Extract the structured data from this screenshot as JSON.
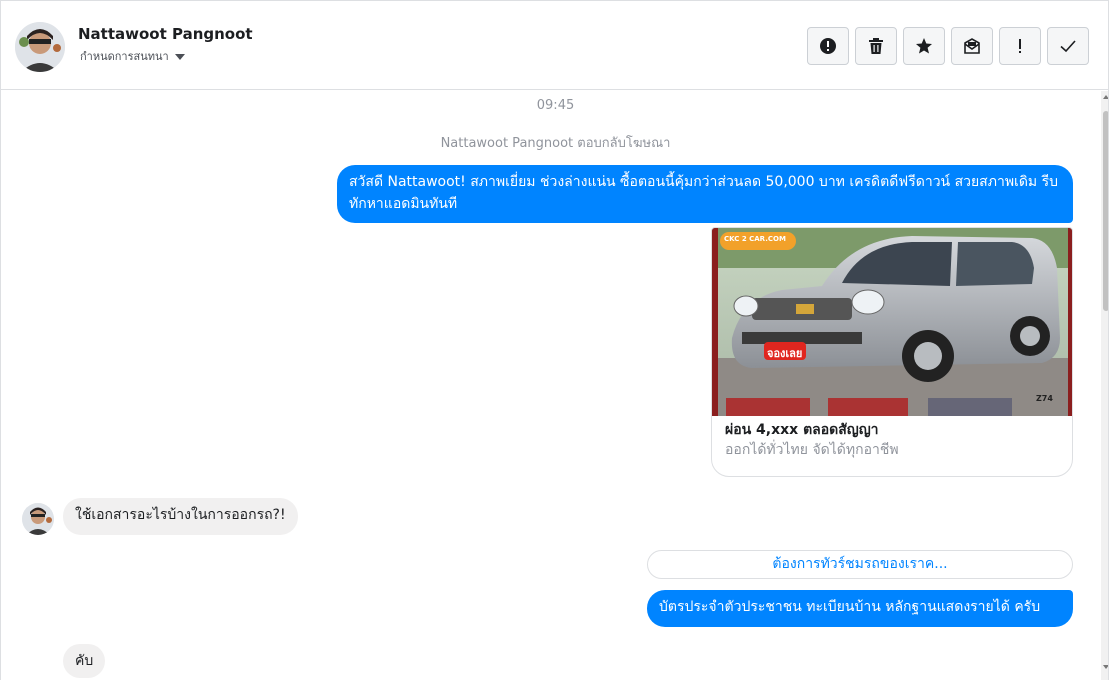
{
  "header": {
    "name": "Nattawoot Pangnoot",
    "subtitle": "กำหนดการสนทนา",
    "actions": [
      {
        "icon": "exclamation-circle-icon",
        "label": "report"
      },
      {
        "icon": "trash-icon",
        "label": "delete"
      },
      {
        "icon": "star-icon",
        "label": "star"
      },
      {
        "icon": "mail-unread-icon",
        "label": "mark-unread"
      },
      {
        "icon": "exclamation-icon",
        "label": "important"
      },
      {
        "icon": "checkmark-icon",
        "label": "done"
      }
    ]
  },
  "thread": {
    "timestamp": "09:45",
    "meta_note": "Nattawoot Pangnoot ตอบกลับโฆษณา",
    "messages": [
      {
        "from": "page",
        "text": "สวัสดี Nattawoot!  สภาพเยี่ยม ช่วงล่างแน่น  ซื้อตอนนี้คุ้มกว่าส่วนลด 50,000 บาท เครดิตดีฟรีดาวน์  สวยสภาพเดิม รีบทักหาแอดมินทันที"
      },
      {
        "from": "user",
        "text": "ใช้เอกสารอะไรบ้างในการออกรถ?!"
      },
      {
        "from": "page",
        "text": "บัตรประจำตัวประชาชน ทะเบียนบ้าน หลักฐานแสดงรายได้ ครับ"
      },
      {
        "from": "user",
        "text": "คับ"
      }
    ],
    "ad_card": {
      "logo_text": "CKC 2 CAR.COM",
      "badge_text": "จองเลย",
      "plate_text": "Z74",
      "title": "ผ่อน 4,xxx ตลอดสัญญา",
      "subtitle": "ออกได้ทั่วไทย จัดได้ทุกอาชีพ"
    },
    "quick_reply": "ต้องการทัวร์ชมรถของเราค..."
  },
  "colors": {
    "accent": "#0084ff",
    "incoming_bubble": "#f1f0f0",
    "border": "#dddfe2",
    "muted_text": "#90949c"
  }
}
